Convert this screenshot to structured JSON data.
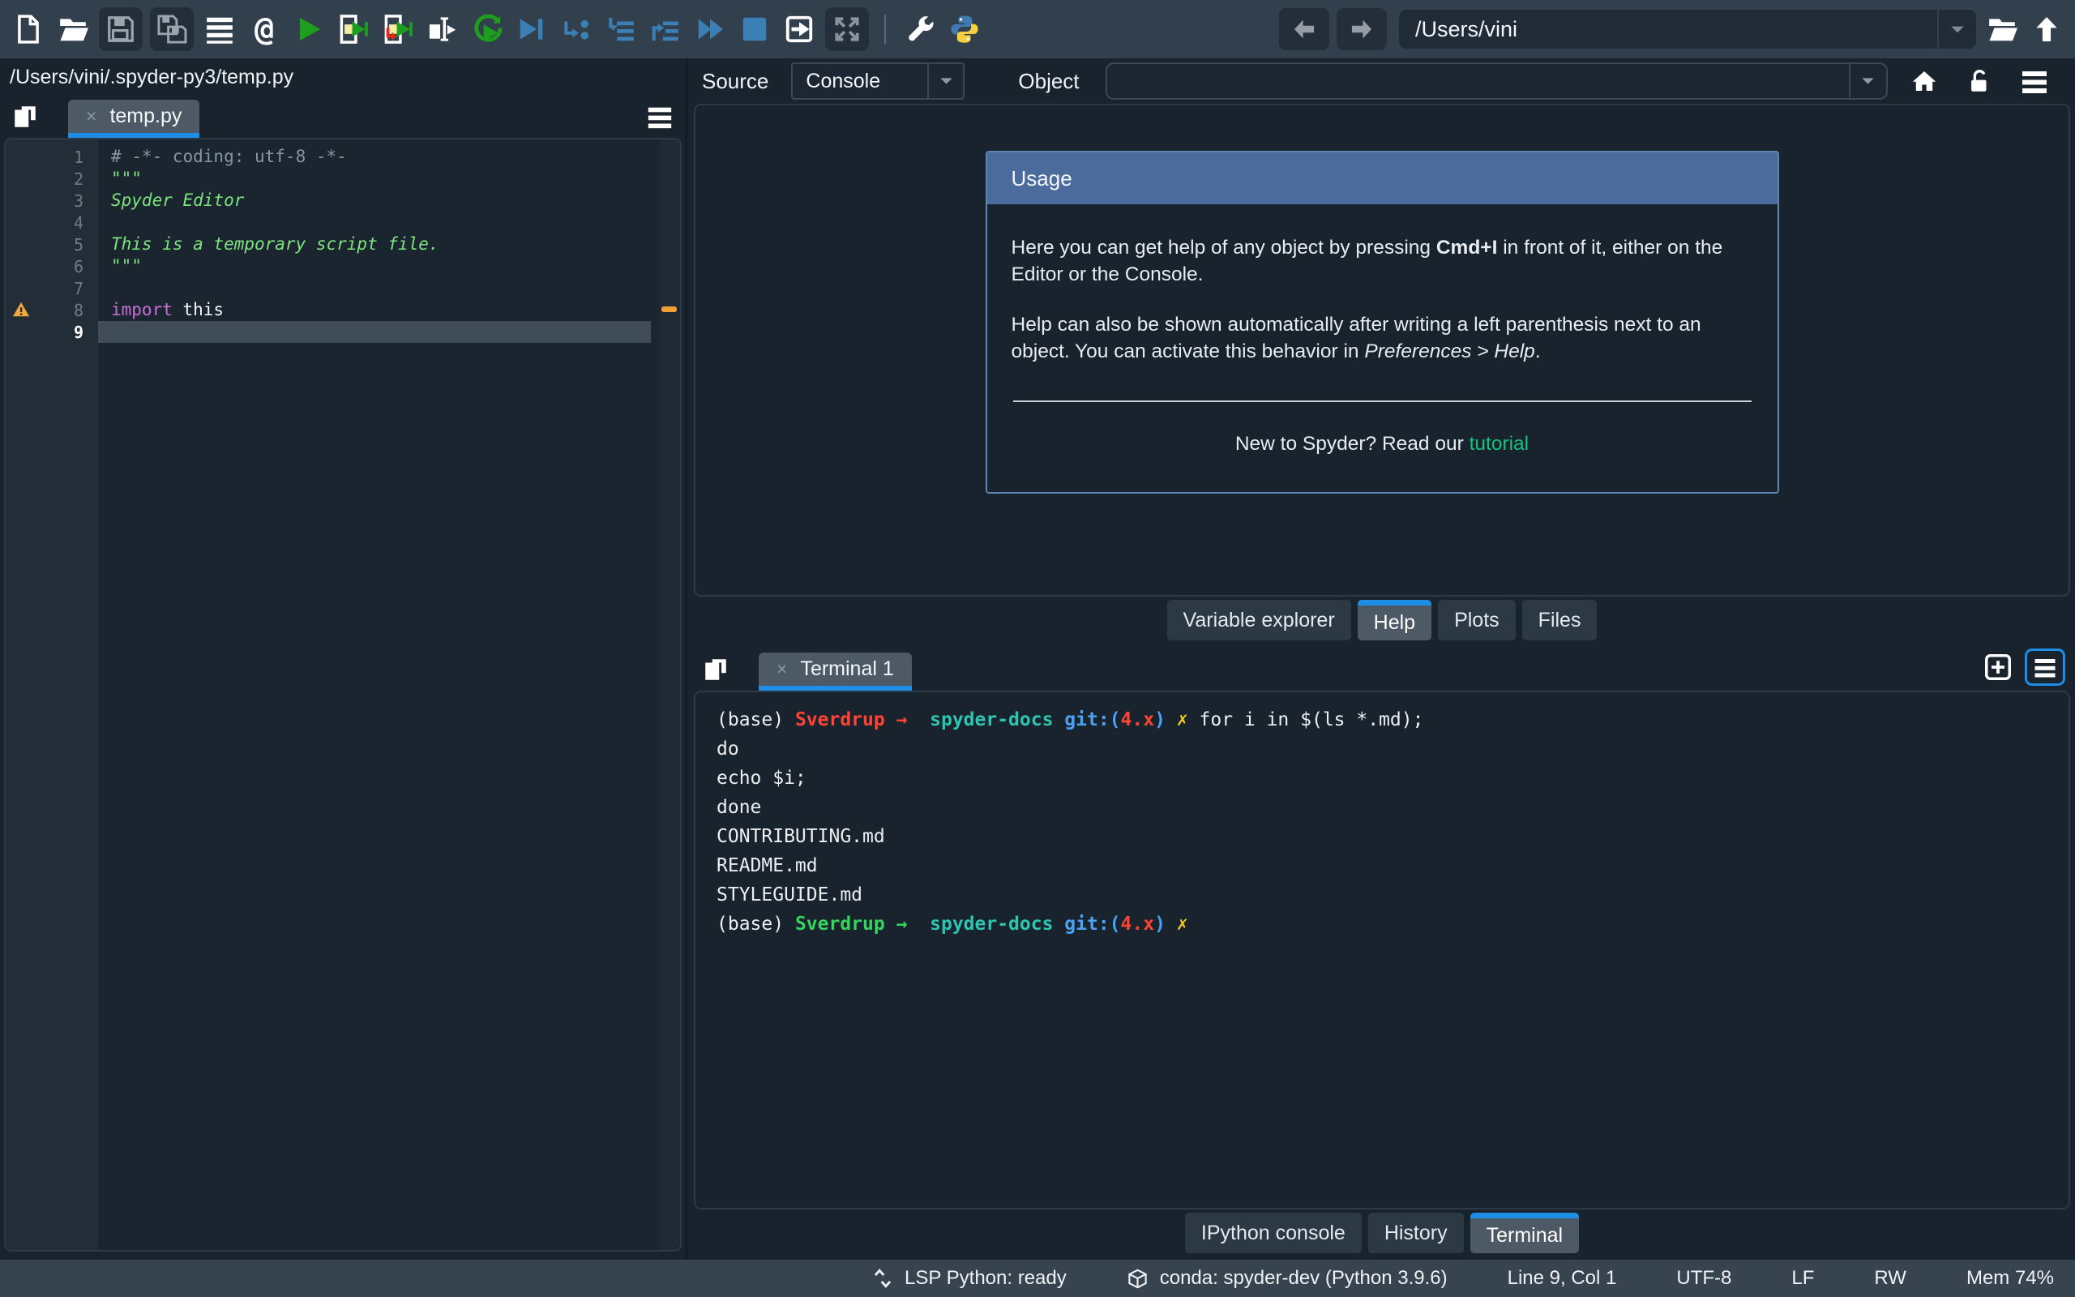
{
  "toolbar": {
    "path_value": "/Users/vini",
    "at_glyph": "@",
    "icon_names": [
      "new-file",
      "open-file",
      "save",
      "save-all",
      "file-switcher",
      "symbol-finder",
      "run-file",
      "run-cell",
      "run-cell-advance",
      "run-selection",
      "rerun-cell",
      "debug-file",
      "debug-cell",
      "debug-step-over",
      "debug-step-into",
      "debug-continue",
      "debug-stop",
      "new-window",
      "maximize-pane",
      "preferences",
      "pythonpath-manager",
      "back",
      "forward",
      "working-directory",
      "browse-working-directory",
      "parent-directory"
    ]
  },
  "editor": {
    "breadcrumb": "/Users/vini/.spyder-py3/temp.py",
    "tab_label": "temp.py",
    "close_glyph": "×",
    "lines": [
      {
        "n": "1",
        "segs": [
          {
            "t": "# -*- coding: utf-8 -*-",
            "c": "comment"
          }
        ]
      },
      {
        "n": "2",
        "segs": [
          {
            "t": "\"\"\"",
            "c": "string"
          }
        ]
      },
      {
        "n": "3",
        "segs": [
          {
            "t": "Spyder Editor",
            "c": "string-italic"
          }
        ]
      },
      {
        "n": "4",
        "segs": []
      },
      {
        "n": "5",
        "segs": [
          {
            "t": "This is a temporary script file.",
            "c": "string-italic"
          }
        ]
      },
      {
        "n": "6",
        "segs": [
          {
            "t": "\"\"\"",
            "c": "string"
          }
        ]
      },
      {
        "n": "7",
        "segs": []
      },
      {
        "n": "8",
        "warn": true,
        "segs": [
          {
            "t": "import",
            "c": "keyword"
          },
          {
            "t": " this",
            "c": "plain"
          }
        ]
      },
      {
        "n": "9",
        "current": true,
        "segs": []
      }
    ]
  },
  "help": {
    "source_label": "Source",
    "source_value": "Console",
    "object_label": "Object",
    "usage_title": "Usage",
    "para1": [
      {
        "t": "Here you can get help of any object by pressing "
      },
      {
        "t": "Cmd+I",
        "b": true
      },
      {
        "t": " in front of it, either on the Editor or the Console."
      }
    ],
    "para2": [
      {
        "t": "Help can also be shown automatically after writing a left parenthesis next to an object. You can activate this behavior in "
      },
      {
        "t": "Preferences > Help",
        "i": true
      },
      {
        "t": "."
      }
    ],
    "footer_text": "New to Spyder? Read our ",
    "footer_link": "tutorial",
    "tabs": [
      {
        "label": "Variable explorer",
        "active": false
      },
      {
        "label": "Help",
        "active": true
      },
      {
        "label": "Plots",
        "active": false
      },
      {
        "label": "Files",
        "active": false
      }
    ]
  },
  "terminal": {
    "tab_label": "Terminal 1",
    "close_glyph": "×",
    "lines": [
      [
        {
          "t": "(base) ",
          "c": "fg"
        },
        {
          "t": "Sverdrup",
          "c": "red"
        },
        {
          "t": " → ",
          "c": "red"
        },
        {
          "t": " ",
          "c": "fg"
        },
        {
          "t": "spyder-docs ",
          "c": "teal"
        },
        {
          "t": "git:(",
          "c": "blue"
        },
        {
          "t": "4.x",
          "c": "red"
        },
        {
          "t": ") ",
          "c": "blue"
        },
        {
          "t": "✗ ",
          "c": "yellow"
        },
        {
          "t": "for i in $(ls *.md);",
          "c": "fg"
        }
      ],
      [
        {
          "t": "do",
          "c": "fg"
        }
      ],
      [
        {
          "t": "echo $i;",
          "c": "fg"
        }
      ],
      [
        {
          "t": "done",
          "c": "fg"
        }
      ],
      [
        {
          "t": "CONTRIBUTING.md",
          "c": "fg"
        }
      ],
      [
        {
          "t": "README.md",
          "c": "fg"
        }
      ],
      [
        {
          "t": "STYLEGUIDE.md",
          "c": "fg"
        }
      ],
      [
        {
          "t": "(base) ",
          "c": "fg"
        },
        {
          "t": "Sverdrup",
          "c": "green"
        },
        {
          "t": " → ",
          "c": "green"
        },
        {
          "t": " ",
          "c": "fg"
        },
        {
          "t": "spyder-docs ",
          "c": "teal"
        },
        {
          "t": "git:(",
          "c": "blue"
        },
        {
          "t": "4.x",
          "c": "red"
        },
        {
          "t": ") ",
          "c": "blue"
        },
        {
          "t": "✗",
          "c": "yellow"
        }
      ]
    ],
    "tabs": [
      {
        "label": "IPython console",
        "active": false
      },
      {
        "label": "History",
        "active": false
      },
      {
        "label": "Terminal",
        "active": true
      }
    ]
  },
  "statusbar": {
    "lsp": "LSP Python: ready",
    "conda": "conda: spyder-dev (Python 3.9.6)",
    "cursor": "Line 9, Col 1",
    "encoding": "UTF-8",
    "eol": "LF",
    "permissions": "RW",
    "memory": "Mem 74%"
  },
  "colors": {
    "accent_blue": "#1e8de6",
    "usage_header": "#4a6b9c",
    "tutorial_link": "#18c07d",
    "warning_orange": "#f0a030",
    "terminal_red": "#ff4336",
    "terminal_green": "#36d45c",
    "terminal_teal": "#2ec5b0",
    "terminal_blue": "#4ba2f4",
    "terminal_yellow": "#f2ca27"
  }
}
